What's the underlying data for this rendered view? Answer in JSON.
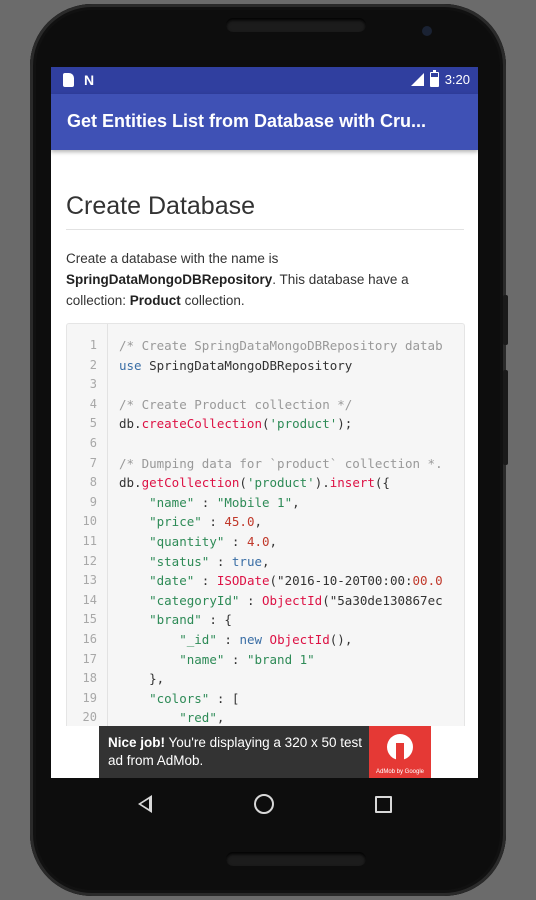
{
  "status_bar": {
    "time": "3:20",
    "icons": [
      "sd-card-icon",
      "n-notification-icon",
      "signal-icon",
      "battery-icon"
    ]
  },
  "app_bar": {
    "title": "Get Entities List from Database with Cru..."
  },
  "article": {
    "heading": "Create Database",
    "paragraph": {
      "part1": "Create a database with the name is ",
      "db_name": "SpringDataMongoDBRepository",
      "part2": ". This database have a collection: ",
      "collection": "Product",
      "part3": " collection."
    }
  },
  "code_block": {
    "lines": [
      {
        "n": "1",
        "text": "/* Create SpringDataMongoDBRepository datab"
      },
      {
        "n": "2",
        "text": "use SpringDataMongoDBRepository"
      },
      {
        "n": "3",
        "text": ""
      },
      {
        "n": "4",
        "text": "/* Create Product collection */"
      },
      {
        "n": "5",
        "text": "db.createCollection('product');"
      },
      {
        "n": "6",
        "text": ""
      },
      {
        "n": "7",
        "text": "/* Dumping data for `product` collection *."
      },
      {
        "n": "8",
        "text": "db.getCollection('product').insert({"
      },
      {
        "n": "9",
        "text": "    \"name\" : \"Mobile 1\","
      },
      {
        "n": "10",
        "text": "    \"price\" : 45.0,"
      },
      {
        "n": "11",
        "text": "    \"quantity\" : 4.0,"
      },
      {
        "n": "12",
        "text": "    \"status\" : true,"
      },
      {
        "n": "13",
        "text": "    \"date\" : ISODate(\"2016-10-20T00:00:00.0"
      },
      {
        "n": "14",
        "text": "    \"categoryId\" : ObjectId(\"5a30de130867ec"
      },
      {
        "n": "15",
        "text": "    \"brand\" : {"
      },
      {
        "n": "16",
        "text": "        \"_id\" : new ObjectId(),"
      },
      {
        "n": "17",
        "text": "        \"name\" : \"brand 1\""
      },
      {
        "n": "18",
        "text": "    },"
      },
      {
        "n": "19",
        "text": "    \"colors\" : ["
      },
      {
        "n": "20",
        "text": "        \"red\","
      }
    ]
  },
  "ad_banner": {
    "bold": "Nice job!",
    "text": " You're displaying a 320 x 50 test ad from AdMob.",
    "logo_caption": "AdMob by Google"
  },
  "nav_bar": {
    "buttons": [
      "back-icon",
      "home-icon",
      "recents-icon"
    ]
  },
  "colors": {
    "status_bar": "#303f9f",
    "app_bar": "#3f51b5",
    "ad_background": "#333333",
    "ad_logo": "#e53935"
  }
}
